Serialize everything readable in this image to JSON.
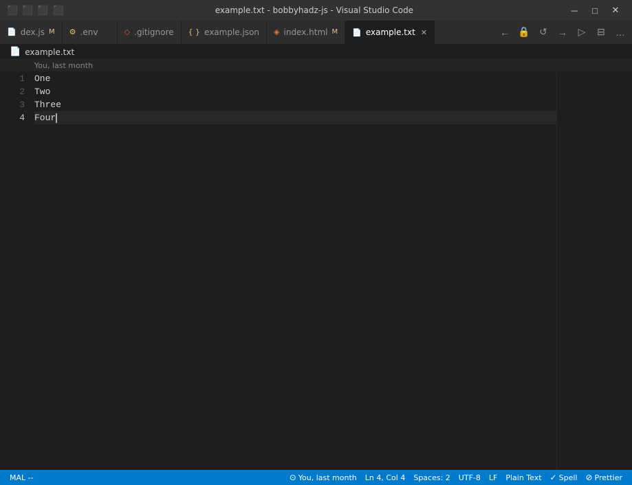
{
  "titleBar": {
    "title": "example.txt - bobbyhadz-js - Visual Studio Code",
    "icons": [
      "⬛",
      "⬛",
      "⬛",
      "⬛"
    ],
    "minimize": "─",
    "maximize": "□",
    "close": "✕"
  },
  "tabs": [
    {
      "id": "dex.js",
      "label": "dex.js",
      "modified": "M",
      "icon": "📄",
      "iconColor": "#75beff",
      "active": false
    },
    {
      "id": "env",
      "label": ".env",
      "modified": "",
      "icon": "⚙",
      "iconColor": "#e8c07d",
      "active": false
    },
    {
      "id": "gitignore",
      "label": ".gitignore",
      "modified": "",
      "icon": "◇",
      "iconColor": "#f14c4c",
      "active": false
    },
    {
      "id": "example.json",
      "label": "example.json",
      "modified": "",
      "icon": "{}",
      "iconColor": "#dbbc7f",
      "active": false
    },
    {
      "id": "index.html",
      "label": "index.html",
      "modified": "M",
      "icon": "◈",
      "iconColor": "#e37933",
      "active": false
    },
    {
      "id": "example.txt",
      "label": "example.txt",
      "modified": "",
      "icon": "📄",
      "iconColor": "#75beff",
      "active": true
    }
  ],
  "breadcrumb": {
    "icon": "📄",
    "filename": "example.txt"
  },
  "gitInfo": {
    "text": "You, last month"
  },
  "editor": {
    "lines": [
      {
        "number": 1,
        "content": "One",
        "cursor": false,
        "highlighted": false
      },
      {
        "number": 2,
        "content": "Two",
        "cursor": false,
        "highlighted": false
      },
      {
        "number": 3,
        "content": "Three",
        "cursor": false,
        "highlighted": false
      },
      {
        "number": 4,
        "content": "Four",
        "cursor": true,
        "highlighted": true
      }
    ]
  },
  "statusBar": {
    "left": {
      "sourceControl": "MAL --"
    },
    "right": [
      {
        "id": "git-author",
        "label": "You, last month",
        "icon": "⊙"
      },
      {
        "id": "position",
        "label": "Ln 4, Col 4"
      },
      {
        "id": "spaces",
        "label": "Spaces: 2"
      },
      {
        "id": "encoding",
        "label": "UTF-8"
      },
      {
        "id": "eol",
        "label": "LF"
      },
      {
        "id": "language",
        "label": "Plain Text"
      },
      {
        "id": "spell",
        "label": "Spell",
        "icon": "✓"
      },
      {
        "id": "prettier",
        "label": "Prettier",
        "icon": "🔵"
      }
    ]
  }
}
